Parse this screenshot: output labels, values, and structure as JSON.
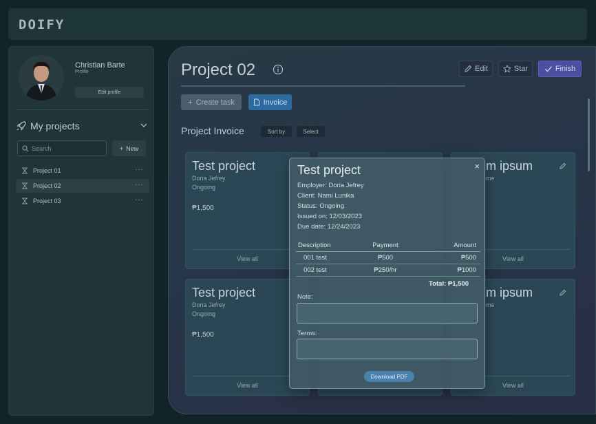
{
  "app": {
    "logo": "DOIFY"
  },
  "profile": {
    "name": "Christian Barte",
    "subtitle": "Profile",
    "edit_label": "Edit profile"
  },
  "sidebar": {
    "section_title": "My projects",
    "search_placeholder": "Search",
    "new_label": "New",
    "projects": [
      {
        "label": "Project 01",
        "active": false
      },
      {
        "label": "Project 02",
        "active": true
      },
      {
        "label": "Project 03",
        "active": false
      }
    ],
    "more_glyph": "···"
  },
  "main": {
    "title": "Project 02",
    "actions": {
      "edit": "Edit",
      "star": "Star",
      "finish": "Finish"
    },
    "create_task": "Create task",
    "invoice": "Invoice",
    "section_title": "Project Invoice",
    "sort_by": "Sort by",
    "select": "Select",
    "cards": [
      {
        "title": "Test project",
        "client": "Doria Jefrey",
        "status": "Ongoing",
        "amount": "₱1,500",
        "view": "View all"
      },
      {
        "title": "Lorem ipsum",
        "client": "me",
        "status": "",
        "amount": "",
        "view": "View all"
      },
      {
        "title": "Test project",
        "client": "Doria Jefrey",
        "status": "Ongoing",
        "amount": "₱1,500",
        "view": "View all"
      },
      {
        "title": "Lorem ipsum",
        "client": "me",
        "status": "",
        "amount": "",
        "view": "View all"
      }
    ],
    "visible_card_titles": {
      "right_top": "m ipsum",
      "right_bottom": "m ipsum",
      "right_sub": "me"
    }
  },
  "modal": {
    "title": "Test project",
    "close_glyph": "×",
    "details": [
      "Employer: Doria Jefrey",
      "Client: Nami Lunika",
      "Status: Ongoing",
      "Issued on: 12/03/2023",
      "Due date: 12/24/2023"
    ],
    "table": {
      "headers": [
        "Description",
        "Payment",
        "Amount"
      ],
      "rows": [
        [
          "001 test",
          "₱500",
          "₱500"
        ],
        [
          "002 test",
          "₱250/hr",
          "₱1000"
        ]
      ]
    },
    "total": "Total: ₱1,500",
    "note_label": "Note:",
    "terms_label": "Terms:",
    "download_label": "Download PDF"
  }
}
